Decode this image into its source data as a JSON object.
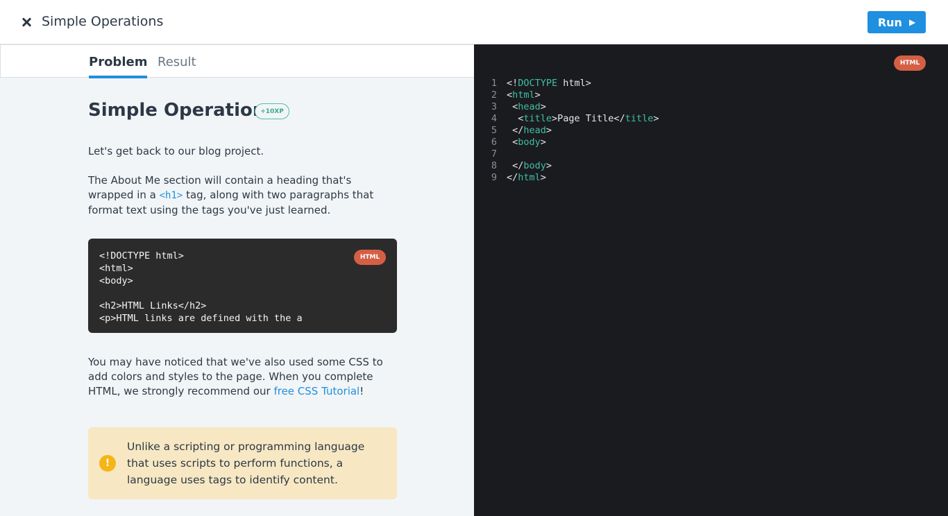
{
  "header": {
    "title": "Simple Operations",
    "run_label": "Run",
    "run_icon": "play-icon",
    "close_icon": "close-icon"
  },
  "tabs": [
    {
      "label": "Problem",
      "active": true
    },
    {
      "label": "Result",
      "active": false
    }
  ],
  "lesson": {
    "title": "Simple Operations",
    "xp": "+10XP",
    "p1": "Let's get back to our blog project.",
    "p2_a": "The About Me section will contain a heading that's wrapped in a ",
    "p2_code": "<h1>",
    "p2_b": " tag, along with two paragraphs that format text using the tags you've just learned.",
    "code_badge": "HTML",
    "code_sample": "<!DOCTYPE html>\n<html>\n<body>\n\n<h2>HTML Links</h2>\n<p>HTML links are defined with the a",
    "p3_a": "You may have noticed that we've also used some CSS to add colors and styles to the page. When you complete HTML, we strongly recommend our ",
    "p3_link": "free CSS Tutorial",
    "p3_b": "!",
    "note": "Unlike a scripting or programming language that uses scripts to perform functions, a language uses tags to identify content.",
    "note_icon": "!"
  },
  "editor": {
    "badge": "HTML",
    "lines": [
      {
        "n": "1",
        "code": "<!DOCTYPE html>"
      },
      {
        "n": "2",
        "code": "<html>"
      },
      {
        "n": "3",
        "code": " <head>"
      },
      {
        "n": "4",
        "code": "  <title>Page Title</title>"
      },
      {
        "n": "5",
        "code": " </head>"
      },
      {
        "n": "6",
        "code": " <body>"
      },
      {
        "n": "7",
        "code": ""
      },
      {
        "n": "8",
        "code": " </body>"
      },
      {
        "n": "9",
        "code": "</html>"
      }
    ]
  },
  "colors": {
    "accent": "#1f8fe0",
    "badge": "#d55f45",
    "xp": "#4fc19a",
    "note_bg": "#f7e8c3",
    "warn": "#f5b517",
    "editor_bg": "#1a1b1f",
    "tag_green": "#3fbfa5"
  }
}
